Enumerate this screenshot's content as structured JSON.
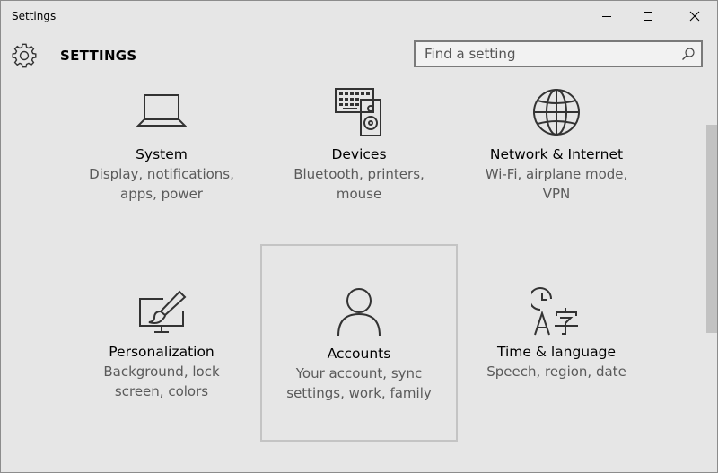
{
  "window": {
    "title": "Settings"
  },
  "header": {
    "title": "SETTINGS"
  },
  "search": {
    "placeholder": "Find a setting",
    "value": ""
  },
  "tiles": [
    {
      "name": "System",
      "desc1": "Display, notifications,",
      "desc2": "apps, power",
      "icon": "laptop-icon"
    },
    {
      "name": "Devices",
      "desc1": "Bluetooth, printers,",
      "desc2": "mouse",
      "icon": "keyboard-speaker-icon"
    },
    {
      "name": "Network & Internet",
      "desc1": "Wi-Fi, airplane mode,",
      "desc2": "VPN",
      "icon": "globe-icon"
    },
    {
      "name": "Personalization",
      "desc1": "Background, lock",
      "desc2": "screen, colors",
      "icon": "paintbrush-monitor-icon"
    },
    {
      "name": "Accounts",
      "desc1": "Your account, sync",
      "desc2": "settings, work, family",
      "icon": "person-icon",
      "selected": true
    },
    {
      "name": "Time & language",
      "desc1": "Speech, region, date",
      "desc2": "",
      "icon": "clock-language-icon"
    }
  ],
  "colors": {
    "background": "#e6e6e6",
    "icon_stroke": "#333333",
    "description_text": "#5a5a5a"
  }
}
